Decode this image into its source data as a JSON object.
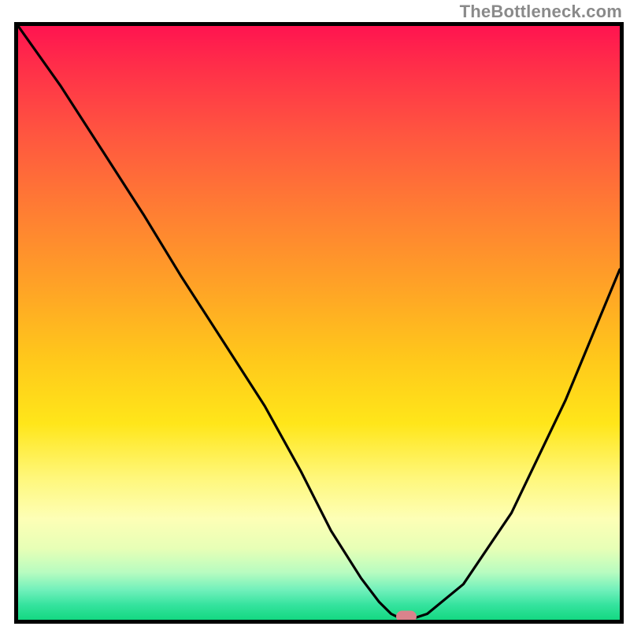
{
  "watermark": "TheBottleneck.com",
  "colors": {
    "frame_border": "#000000",
    "curve_stroke": "#000000",
    "marker_fill": "#d9838c",
    "gradient_stops": [
      "#ff1450",
      "#ff2f49",
      "#ff5540",
      "#ff7a34",
      "#ffa326",
      "#ffc81b",
      "#ffe61a",
      "#fff77a",
      "#fdffb6",
      "#e7ffb6",
      "#b8fcc0",
      "#70f0bb",
      "#35e39e",
      "#14d882"
    ]
  },
  "chart_data": {
    "type": "line",
    "title": "",
    "xlabel": "",
    "ylabel": "",
    "xlim": [
      0,
      100
    ],
    "ylim": [
      0,
      100
    ],
    "grid": false,
    "series": [
      {
        "name": "bottleneck-curve",
        "x": [
          0,
          7,
          14,
          21,
          27,
          34,
          41,
          47,
          52,
          57,
          60,
          62,
          64,
          65,
          68,
          74,
          82,
          91,
          100
        ],
        "values": [
          100,
          90,
          79,
          68,
          58,
          47,
          36,
          25,
          15,
          7,
          3,
          1,
          0,
          0,
          1,
          6,
          18,
          37,
          59
        ]
      }
    ],
    "marker": {
      "x": 64.5,
      "y": 0.5
    },
    "note": "x and y in percent of plot area; y measured from bottom (0 = green floor, 100 = top)"
  }
}
